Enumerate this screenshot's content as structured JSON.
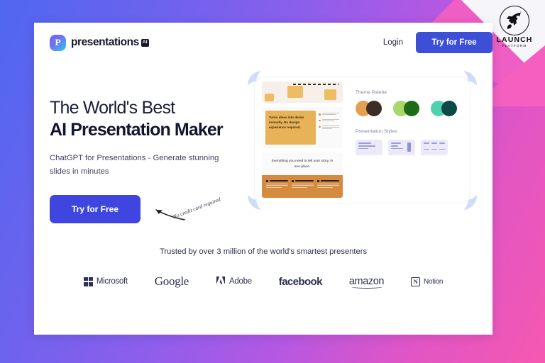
{
  "watermark": {
    "icon": "rocket-icon",
    "wordmark": "LAUNCH",
    "subword": "PLATFORM"
  },
  "header": {
    "brand_mark": "P",
    "brand_name": "presentations",
    "brand_badge": "AI",
    "login_label": "Login",
    "cta_label": "Try for Free"
  },
  "hero": {
    "headline_line1": "The World's Best",
    "headline_line2": "AI Presentation Maker",
    "subheadline": "ChatGPT for Presentations - Generate stunning slides in minutes",
    "cta_label": "Try for Free",
    "cta_note": "No credit card required"
  },
  "hero_visual": {
    "slide_2_text": "Turns ideas into decks instantly. No design experience required.",
    "slide_3_title": "Everything you need to tell your story, in one place.",
    "theme_palette_label": "Theme Palette",
    "palettes": [
      {
        "outer": "#e3a055",
        "inner": "#3a2e26"
      },
      {
        "outer": "#a8d76a",
        "inner": "#1e6b16"
      },
      {
        "outer": "#4fd0b0",
        "inner": "#0c4a47"
      }
    ],
    "styles_label": "Presentation Styles"
  },
  "trusted": {
    "text": "Trusted by over 3 million of the world's smartest presenters",
    "logos": [
      {
        "name": "Microsoft",
        "icon": "microsoft-grid-icon"
      },
      {
        "name": "Google",
        "icon": "google-wordmark-icon"
      },
      {
        "name": "Adobe",
        "icon": "adobe-a-icon"
      },
      {
        "name": "facebook",
        "icon": "facebook-wordmark-icon"
      },
      {
        "name": "amazon",
        "icon": "amazon-wordmark-icon"
      },
      {
        "name": "Notion",
        "icon": "notion-n-icon"
      }
    ]
  },
  "colors": {
    "primary_blue": "#3f46e0",
    "nav_blue": "#3d4fd6",
    "pink": "#ef5ec4",
    "headline": "#13142e"
  }
}
